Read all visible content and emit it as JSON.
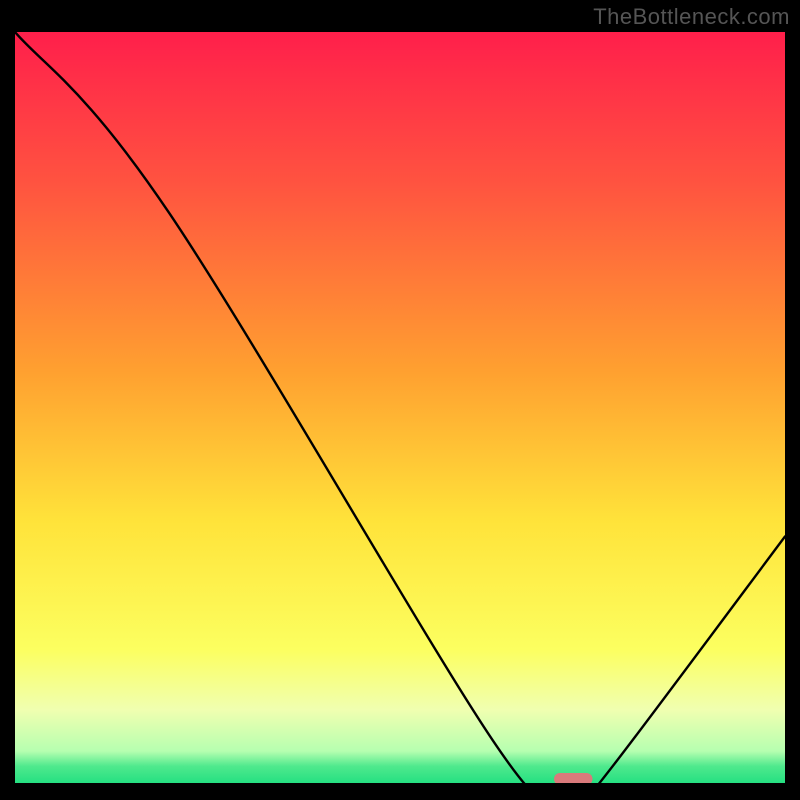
{
  "watermark": "TheBottleneck.com",
  "chart_data": {
    "type": "line",
    "title": "",
    "xlabel": "",
    "ylabel": "",
    "xlim": [
      0,
      100
    ],
    "ylim": [
      0,
      100
    ],
    "series": [
      {
        "name": "bottleneck-curve",
        "x": [
          0,
          20,
          62,
          70,
          72,
          75,
          78,
          100
        ],
        "values": [
          100,
          76,
          6,
          0,
          0,
          0,
          3,
          33
        ]
      }
    ],
    "marker": {
      "x_range": [
        70,
        75
      ],
      "color": "#d97a7b"
    },
    "background_gradient": {
      "stops": [
        {
          "offset": 0.0,
          "color": "#ff1f4b"
        },
        {
          "offset": 0.2,
          "color": "#ff5340"
        },
        {
          "offset": 0.45,
          "color": "#ffa030"
        },
        {
          "offset": 0.65,
          "color": "#ffe33a"
        },
        {
          "offset": 0.82,
          "color": "#fcff60"
        },
        {
          "offset": 0.9,
          "color": "#f0ffb0"
        },
        {
          "offset": 0.955,
          "color": "#b6ffb0"
        },
        {
          "offset": 0.975,
          "color": "#4fe98d"
        },
        {
          "offset": 1.0,
          "color": "#20df80"
        }
      ]
    }
  }
}
